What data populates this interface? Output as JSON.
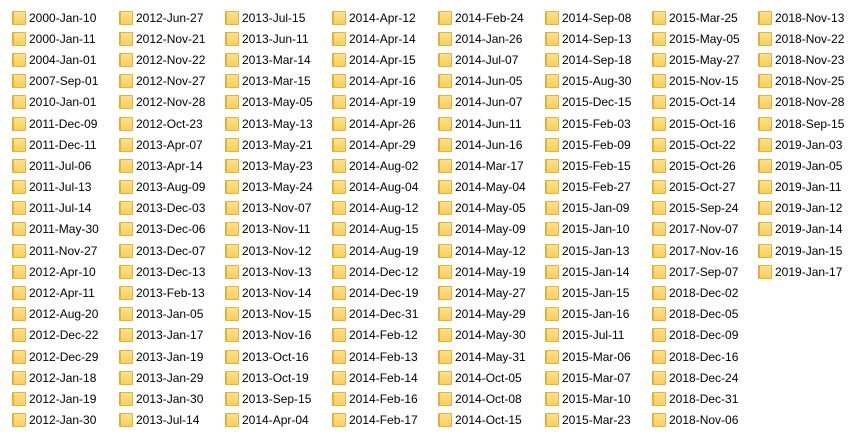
{
  "folder_view": {
    "icon": "folder-icon",
    "columns": [
      {
        "items": [
          "2000-Jan-10",
          "2000-Jan-11",
          "2004-Jan-01",
          "2007-Sep-01",
          "2010-Jan-01",
          "2011-Dec-09",
          "2011-Dec-11",
          "2011-Jul-06",
          "2011-Jul-13",
          "2011-Jul-14",
          "2011-May-30",
          "2011-Nov-27",
          "2012-Apr-10",
          "2012-Apr-11",
          "2012-Aug-20",
          "2012-Dec-22",
          "2012-Dec-29",
          "2012-Jan-18",
          "2012-Jan-19",
          "2012-Jan-30"
        ]
      },
      {
        "items": [
          "2012-Jun-27",
          "2012-Nov-21",
          "2012-Nov-22",
          "2012-Nov-27",
          "2012-Nov-28",
          "2012-Oct-23",
          "2013-Apr-07",
          "2013-Apr-14",
          "2013-Aug-09",
          "2013-Dec-03",
          "2013-Dec-06",
          "2013-Dec-07",
          "2013-Dec-13",
          "2013-Feb-13",
          "2013-Jan-05",
          "2013-Jan-17",
          "2013-Jan-19",
          "2013-Jan-29",
          "2013-Jan-30",
          "2013-Jul-14"
        ]
      },
      {
        "items": [
          "2013-Jul-15",
          "2013-Jun-11",
          "2013-Mar-14",
          "2013-Mar-15",
          "2013-May-05",
          "2013-May-13",
          "2013-May-21",
          "2013-May-23",
          "2013-May-24",
          "2013-Nov-07",
          "2013-Nov-11",
          "2013-Nov-12",
          "2013-Nov-13",
          "2013-Nov-14",
          "2013-Nov-15",
          "2013-Nov-16",
          "2013-Oct-16",
          "2013-Oct-19",
          "2013-Sep-15",
          "2014-Apr-04"
        ]
      },
      {
        "items": [
          "2014-Apr-12",
          "2014-Apr-14",
          "2014-Apr-15",
          "2014-Apr-16",
          "2014-Apr-19",
          "2014-Apr-26",
          "2014-Apr-29",
          "2014-Aug-02",
          "2014-Aug-04",
          "2014-Aug-12",
          "2014-Aug-15",
          "2014-Aug-19",
          "2014-Dec-12",
          "2014-Dec-19",
          "2014-Dec-31",
          "2014-Feb-12",
          "2014-Feb-13",
          "2014-Feb-14",
          "2014-Feb-16",
          "2014-Feb-17"
        ]
      },
      {
        "items": [
          "2014-Feb-24",
          "2014-Jan-26",
          "2014-Jul-07",
          "2014-Jun-05",
          "2014-Jun-07",
          "2014-Jun-11",
          "2014-Jun-16",
          "2014-Mar-17",
          "2014-May-04",
          "2014-May-05",
          "2014-May-09",
          "2014-May-12",
          "2014-May-19",
          "2014-May-27",
          "2014-May-29",
          "2014-May-30",
          "2014-May-31",
          "2014-Oct-05",
          "2014-Oct-08",
          "2014-Oct-15"
        ]
      },
      {
        "items": [
          "2014-Sep-08",
          "2014-Sep-13",
          "2014-Sep-18",
          "2015-Aug-30",
          "2015-Dec-15",
          "2015-Feb-03",
          "2015-Feb-09",
          "2015-Feb-15",
          "2015-Feb-27",
          "2015-Jan-09",
          "2015-Jan-10",
          "2015-Jan-13",
          "2015-Jan-14",
          "2015-Jan-15",
          "2015-Jan-16",
          "2015-Jul-11",
          "2015-Mar-06",
          "2015-Mar-07",
          "2015-Mar-10",
          "2015-Mar-23"
        ]
      },
      {
        "items": [
          "2015-Mar-25",
          "2015-May-05",
          "2015-May-27",
          "2015-Nov-15",
          "2015-Oct-14",
          "2015-Oct-16",
          "2015-Oct-22",
          "2015-Oct-26",
          "2015-Oct-27",
          "2015-Sep-24",
          "2017-Nov-07",
          "2017-Nov-16",
          "2017-Sep-07",
          "2018-Dec-02",
          "2018-Dec-05",
          "2018-Dec-09",
          "2018-Dec-16",
          "2018-Dec-24",
          "2018-Dec-31",
          "2018-Nov-06"
        ]
      },
      {
        "items": [
          "2018-Nov-13",
          "2018-Nov-22",
          "2018-Nov-23",
          "2018-Nov-25",
          "2018-Nov-28",
          "2018-Sep-15",
          "2019-Jan-03",
          "2019-Jan-05",
          "2019-Jan-11",
          "2019-Jan-12",
          "2019-Jan-14",
          "2019-Jan-15",
          "2019-Jan-17"
        ]
      }
    ]
  }
}
